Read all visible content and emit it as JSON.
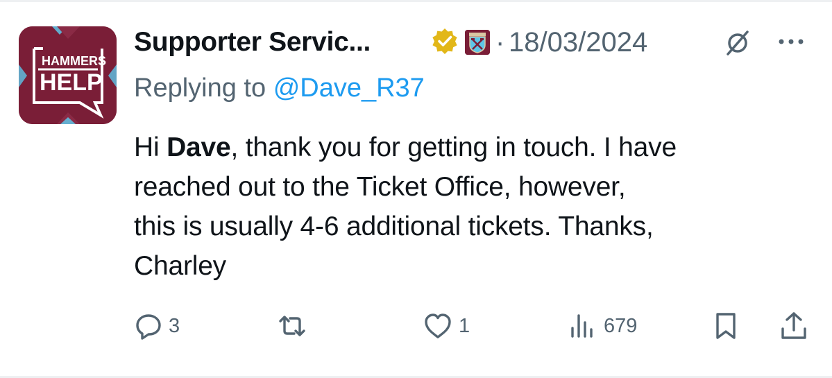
{
  "tweet": {
    "display_name": "Supporter Servic...",
    "separator": "·",
    "date": "18/03/2024",
    "replying_prefix": "Replying to",
    "replying_handle": "@Dave_R37",
    "body": {
      "greeting": "Hi ",
      "name": "Dave",
      "line1_rest": ", thank you for getting in touch. I have",
      "line2": "reached out to the Ticket Office, however,",
      "line3": "this is usually 4-6 additional tickets. Thanks,",
      "line4": "Charley"
    }
  },
  "avatar": {
    "logo_lines": [
      "HAMMERS",
      "HELP"
    ],
    "background_color": "#7a1e37",
    "accent_color": "#5ec6e8"
  },
  "badges": {
    "verified": "gold-verified-check-icon",
    "affiliate": "west-ham-crest-icon",
    "verified_color": "#e2b719"
  },
  "actions": {
    "replies": "3",
    "reposts": "",
    "likes": "1",
    "views": "679"
  },
  "colors": {
    "text": "#0f1419",
    "muted": "#536471",
    "link": "#1d9bf0"
  }
}
